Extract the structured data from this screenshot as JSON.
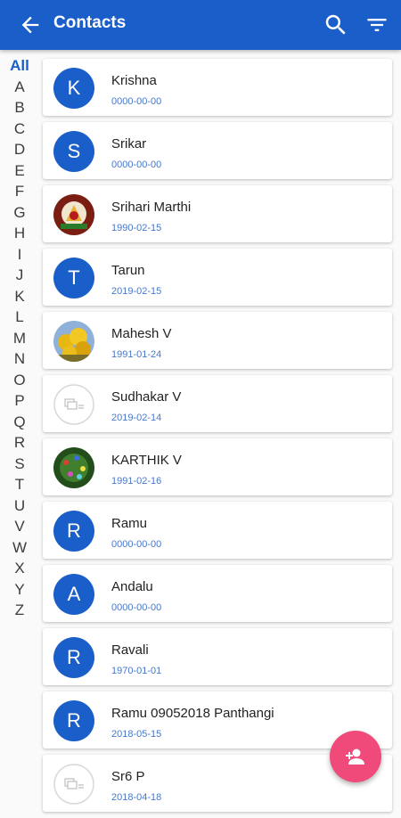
{
  "header": {
    "title": "Contacts",
    "icons": [
      "back-arrow-icon",
      "search-icon",
      "filter-icon"
    ]
  },
  "alphabet_index": [
    "All",
    "A",
    "B",
    "C",
    "D",
    "E",
    "F",
    "G",
    "H",
    "I",
    "J",
    "K",
    "L",
    "M",
    "N",
    "O",
    "P",
    "Q",
    "R",
    "S",
    "T",
    "U",
    "V",
    "W",
    "X",
    "Y",
    "Z"
  ],
  "contacts": [
    {
      "name": "Krishna",
      "date": "0000-00-00",
      "initial": "K"
    },
    {
      "name": "Srikar",
      "date": "0000-00-00",
      "initial": "S"
    },
    {
      "name": "Srihari Marthi",
      "date": "1990-02-15",
      "avatar": "photo-temple"
    },
    {
      "name": "Tarun",
      "date": "2019-02-15",
      "initial": "T"
    },
    {
      "name": "Mahesh V",
      "date": "1991-01-24",
      "avatar": "photo-flowers"
    },
    {
      "name": "Sudhakar V",
      "date": "2019-02-14",
      "avatar": "photo-placeholder"
    },
    {
      "name": "KARTHIK V",
      "date": "1991-02-16",
      "avatar": "photo-green"
    },
    {
      "name": "Ramu",
      "date": "0000-00-00",
      "initial": "R"
    },
    {
      "name": "Andalu",
      "date": "0000-00-00",
      "initial": "A"
    },
    {
      "name": "Ravali",
      "date": "1970-01-01",
      "initial": "R"
    },
    {
      "name": "Ramu 09052018 Panthangi",
      "date": "2018-05-15",
      "initial": "R"
    },
    {
      "name": "Sr6 P",
      "date": "2018-04-18",
      "avatar": "photo-placeholder"
    }
  ],
  "fab": {
    "icon": "add-contact-icon"
  },
  "colors": {
    "primary": "#1a5fc9",
    "fab": "#ef4a7a",
    "date": "#4a78c8"
  }
}
